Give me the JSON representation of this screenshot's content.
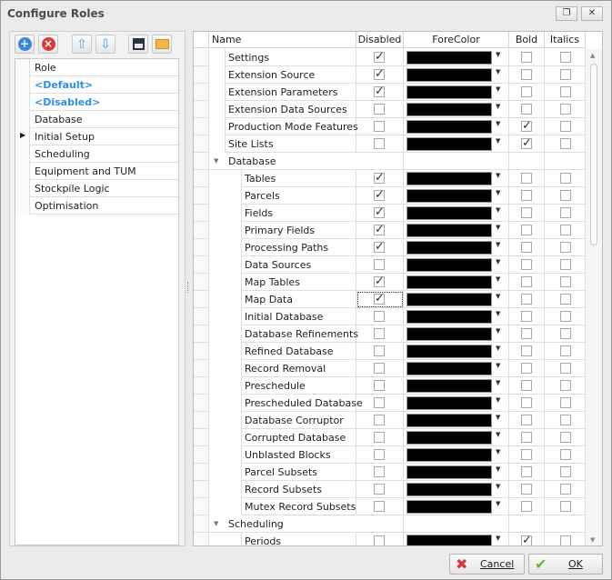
{
  "window": {
    "title": "Configure Roles",
    "restore_label": "❐",
    "close_label": "✕"
  },
  "toolbar": {
    "add": "add-icon",
    "remove": "remove-icon",
    "up": "arrow-up-icon",
    "down": "arrow-down-icon",
    "save": "save-icon",
    "open": "folder-icon"
  },
  "roles": {
    "header": "Role",
    "items": [
      {
        "label": "<Default>",
        "special": true
      },
      {
        "label": "<Disabled>",
        "special": true
      },
      {
        "label": "Database"
      },
      {
        "label": "Initial Setup",
        "current": true
      },
      {
        "label": "Scheduling"
      },
      {
        "label": "Equipment and TUM"
      },
      {
        "label": "Stockpile Logic"
      },
      {
        "label": "Optimisation"
      }
    ]
  },
  "grid": {
    "columns": {
      "name": "Name",
      "disabled": "Disabled",
      "forecolor": "ForeColor",
      "bold": "Bold",
      "italics": "Italics"
    },
    "forecolor_value": "#000000",
    "rows": [
      {
        "name": "Settings",
        "level": 1,
        "disabled": true,
        "bold": false,
        "italics": false
      },
      {
        "name": "Extension Source",
        "level": 1,
        "disabled": true,
        "bold": false,
        "italics": false
      },
      {
        "name": "Extension Parameters",
        "level": 1,
        "disabled": true,
        "bold": false,
        "italics": false
      },
      {
        "name": "Extension Data Sources",
        "level": 1,
        "disabled": false,
        "bold": false,
        "italics": false
      },
      {
        "name": "Production Mode Features",
        "level": 1,
        "disabled": false,
        "bold": true,
        "italics": false
      },
      {
        "name": "Site Lists",
        "level": 1,
        "disabled": false,
        "bold": true,
        "italics": false
      },
      {
        "name": "Database",
        "group": true
      },
      {
        "name": "Tables",
        "level": 2,
        "disabled": true,
        "bold": false,
        "italics": false
      },
      {
        "name": "Parcels",
        "level": 2,
        "disabled": true,
        "bold": false,
        "italics": false
      },
      {
        "name": "Fields",
        "level": 2,
        "disabled": true,
        "bold": false,
        "italics": false
      },
      {
        "name": "Primary Fields",
        "level": 2,
        "disabled": true,
        "bold": false,
        "italics": false
      },
      {
        "name": "Processing Paths",
        "level": 2,
        "disabled": true,
        "bold": false,
        "italics": false
      },
      {
        "name": "Data Sources",
        "level": 2,
        "disabled": false,
        "bold": false,
        "italics": false
      },
      {
        "name": "Map Tables",
        "level": 2,
        "disabled": true,
        "bold": false,
        "italics": false
      },
      {
        "name": "Map Data",
        "level": 2,
        "disabled": true,
        "bold": false,
        "italics": false,
        "focused": true
      },
      {
        "name": "Initial Database",
        "level": 2,
        "disabled": false,
        "bold": false,
        "italics": false
      },
      {
        "name": "Database Refinements",
        "level": 2,
        "disabled": false,
        "bold": false,
        "italics": false
      },
      {
        "name": "Refined Database",
        "level": 2,
        "disabled": false,
        "bold": false,
        "italics": false
      },
      {
        "name": "Record Removal",
        "level": 2,
        "disabled": false,
        "bold": false,
        "italics": false
      },
      {
        "name": "Preschedule",
        "level": 2,
        "disabled": false,
        "bold": false,
        "italics": false
      },
      {
        "name": "Prescheduled Database",
        "level": 2,
        "disabled": false,
        "bold": false,
        "italics": false
      },
      {
        "name": "Database Corruptor",
        "level": 2,
        "disabled": false,
        "bold": false,
        "italics": false
      },
      {
        "name": "Corrupted Database",
        "level": 2,
        "disabled": false,
        "bold": false,
        "italics": false
      },
      {
        "name": "Unblasted Blocks",
        "level": 2,
        "disabled": false,
        "bold": false,
        "italics": false
      },
      {
        "name": "Parcel Subsets",
        "level": 2,
        "disabled": false,
        "bold": false,
        "italics": false
      },
      {
        "name": "Record Subsets",
        "level": 2,
        "disabled": false,
        "bold": false,
        "italics": false
      },
      {
        "name": "Mutex Record Subsets",
        "level": 2,
        "disabled": false,
        "bold": false,
        "italics": false
      },
      {
        "name": "Scheduling",
        "group": true
      },
      {
        "name": "Periods",
        "level": 2,
        "disabled": false,
        "bold": true,
        "italics": false
      }
    ]
  },
  "buttons": {
    "cancel": "Cancel",
    "ok": "OK"
  }
}
